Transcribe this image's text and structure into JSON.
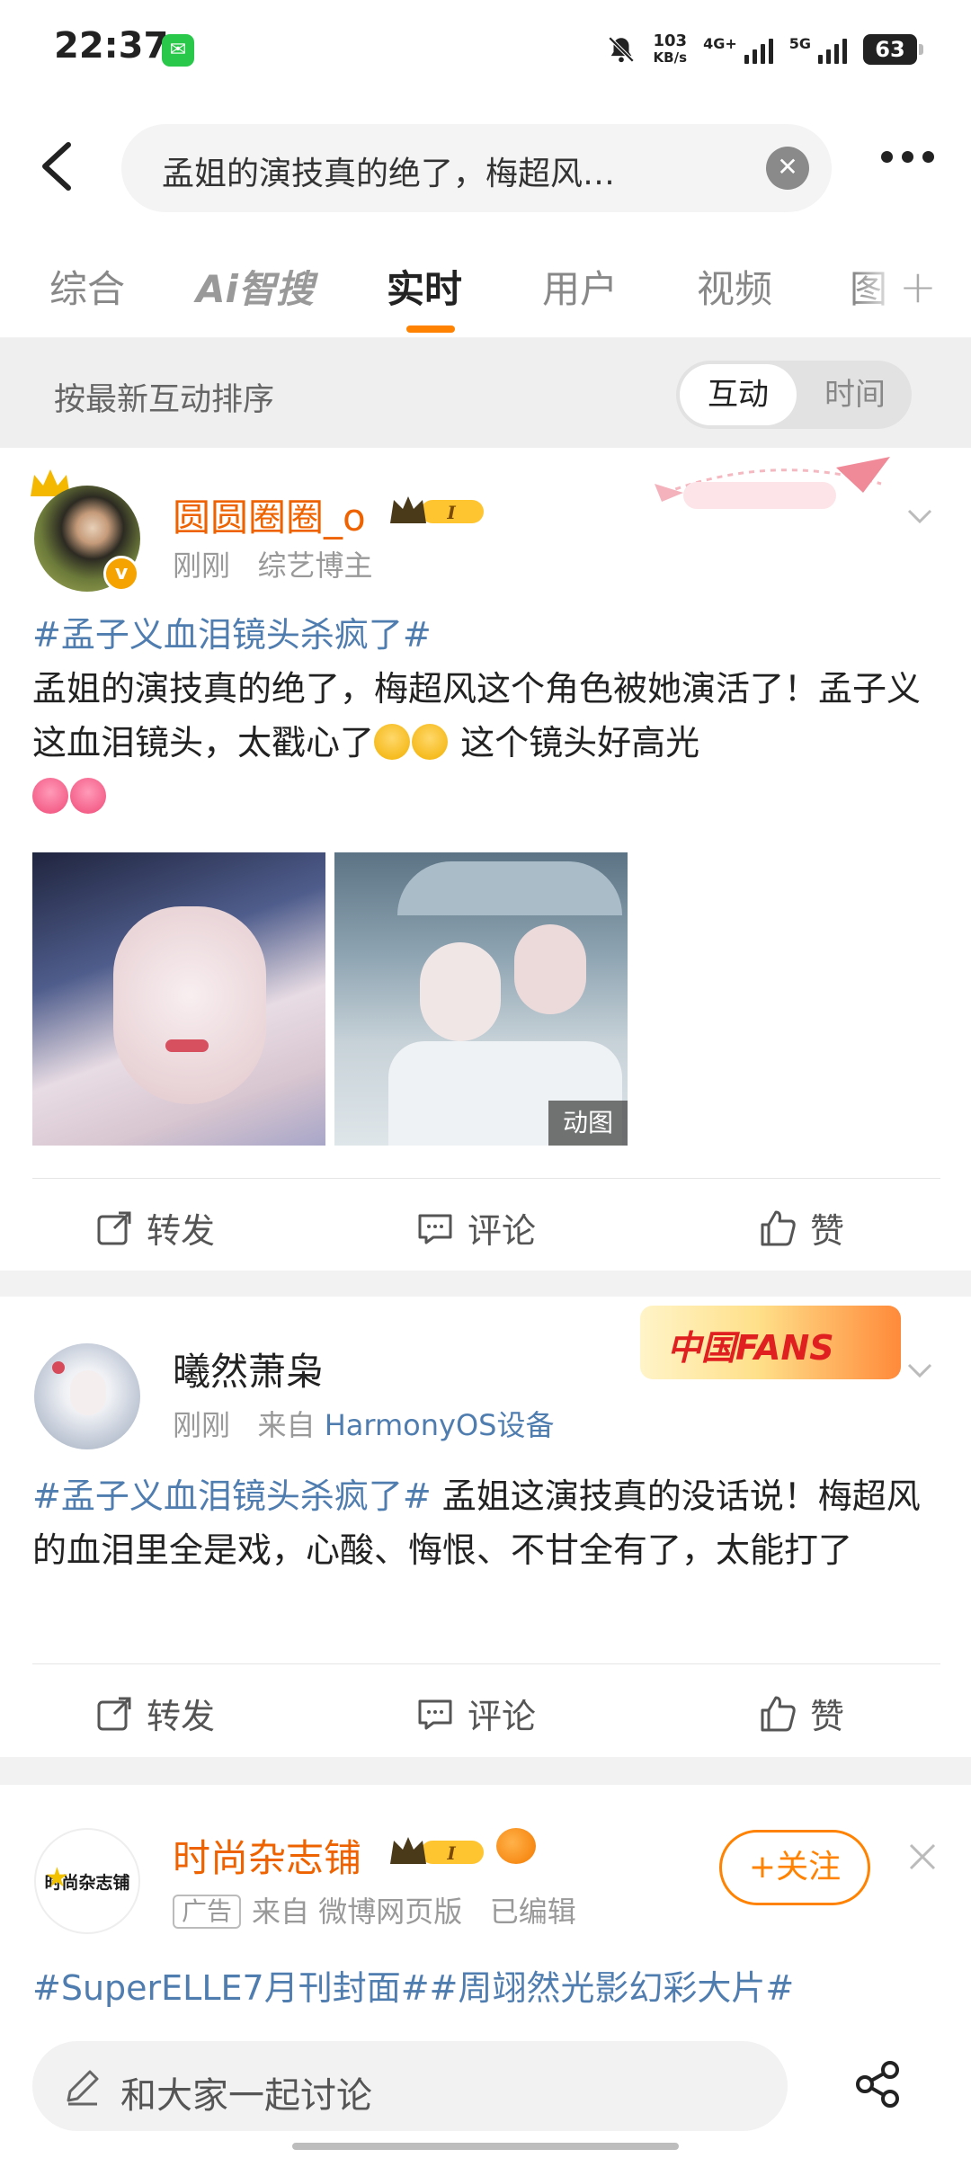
{
  "status_bar": {
    "time": "22:37",
    "net_speed_value": "103",
    "net_speed_unit": "KB/s",
    "signal1": "4G+",
    "signal2": "5G",
    "battery": "63"
  },
  "search": {
    "query": "孟姐的演技真的绝了，梅超风…",
    "clear_icon": "clear-icon",
    "more_icon": "more-dots-icon"
  },
  "tabs": [
    {
      "label": "综合",
      "active": false
    },
    {
      "label": "Ai智搜",
      "active": false
    },
    {
      "label": "实时",
      "active": true
    },
    {
      "label": "用户",
      "active": false
    },
    {
      "label": "视频",
      "active": false
    },
    {
      "label": "图",
      "active": false
    }
  ],
  "sort": {
    "label": "按最新互动排序",
    "options": [
      "互动",
      "时间"
    ],
    "selected": "互动"
  },
  "posts": [
    {
      "username": "圆圆圈圈_o",
      "level_badge": "I",
      "time": "刚刚",
      "source": "综艺博主",
      "hashtag": "#孟子义血泪镜头杀疯了#",
      "text_line1": "孟姐的演技真的绝了，梅超风这个角色被她演活了！孟子义这血泪镜头，太戳心了",
      "text_line2": " 这个镜头好高光",
      "image2_badge": "动图",
      "actions": {
        "repost": "转发",
        "comment": "评论",
        "like": "赞"
      }
    },
    {
      "username": "曦然萧枭",
      "time": "刚刚",
      "source_prefix": "来自",
      "source": "HarmonyOS设备",
      "hashtag": "#孟子义血泪镜头杀疯了#",
      "text": " 孟姐这演技真的没话说！梅超风的血泪里全是戏，心酸、悔恨、不甘全有了，太能打了",
      "sticker_text": "中国FANS",
      "actions": {
        "repost": "转发",
        "comment": "评论",
        "like": "赞"
      }
    },
    {
      "username": "时尚杂志铺",
      "level_badge": "I",
      "ad_tag": "广告",
      "source": "来自 微博网页版",
      "edited": "已编辑",
      "follow_label": "+关注",
      "avatar_text": "时尚杂志铺",
      "hashtags": "#SuperELLE7月刊封面##周翊然光影幻彩大片#"
    }
  ],
  "bottom": {
    "discuss_placeholder": "和大家一起讨论"
  },
  "colors": {
    "accent": "#ff8200",
    "link": "#507daf",
    "vip_name": "#ee6300"
  }
}
